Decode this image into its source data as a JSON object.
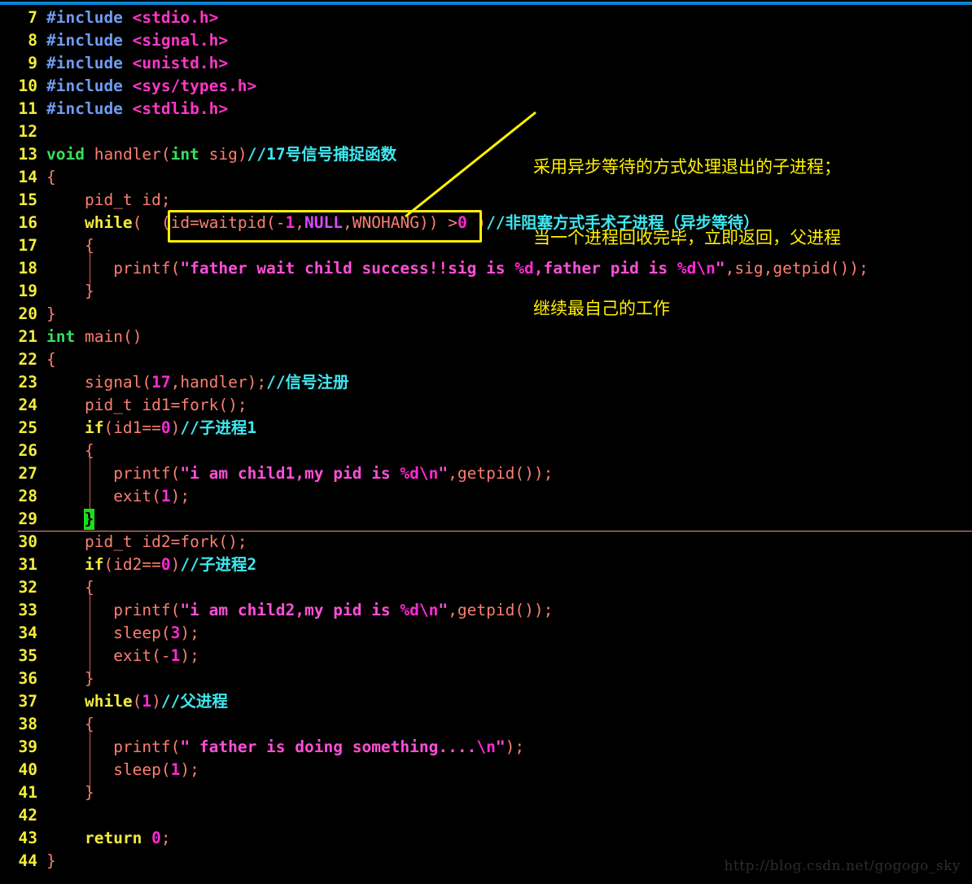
{
  "editor": {
    "background": "#000000",
    "top_strip_color": "#0a84d6",
    "line_number_color": "#f2ec3c",
    "first_line_number": 7,
    "last_line_number": 44
  },
  "cursor": {
    "line": 29,
    "char": "}",
    "block_color": "#19e019",
    "rule_color": "#f58b80"
  },
  "highlight_box": {
    "color": "#fff200",
    "text": "(id=waitpid(-1,NULL,WNOHANG))"
  },
  "annotation": {
    "color": "#fff200",
    "line1": "采用异步等待的方式处理退出的子进程；",
    "line2": "当一个进程回收完毕，立即返回，父进程",
    "line3": "继续最自己的工作"
  },
  "watermark": {
    "text": "http://blog.csdn.net/gogogo_sky"
  },
  "lines": [
    {
      "n": "7",
      "tokens": [
        {
          "c": "t-pre",
          "t": "#include"
        },
        {
          "c": "t-plain",
          "t": " "
        },
        {
          "c": "t-header",
          "t": "<stdio.h>"
        }
      ]
    },
    {
      "n": "8",
      "tokens": [
        {
          "c": "t-pre",
          "t": "#include"
        },
        {
          "c": "t-plain",
          "t": " "
        },
        {
          "c": "t-header",
          "t": "<signal.h>"
        }
      ]
    },
    {
      "n": "9",
      "tokens": [
        {
          "c": "t-pre",
          "t": "#include"
        },
        {
          "c": "t-plain",
          "t": " "
        },
        {
          "c": "t-header",
          "t": "<unistd.h>"
        }
      ]
    },
    {
      "n": "10",
      "tokens": [
        {
          "c": "t-pre",
          "t": "#include"
        },
        {
          "c": "t-plain",
          "t": " "
        },
        {
          "c": "t-header",
          "t": "<sys/types.h>"
        }
      ]
    },
    {
      "n": "11",
      "tokens": [
        {
          "c": "t-pre",
          "t": "#include"
        },
        {
          "c": "t-plain",
          "t": " "
        },
        {
          "c": "t-header",
          "t": "<stdlib.h>"
        }
      ]
    },
    {
      "n": "12",
      "tokens": []
    },
    {
      "n": "13",
      "tokens": [
        {
          "c": "t-kw",
          "t": "void"
        },
        {
          "c": "t-plain",
          "t": " "
        },
        {
          "c": "t-ident",
          "t": "handler"
        },
        {
          "c": "t-punc",
          "t": "("
        },
        {
          "c": "t-kw",
          "t": "int"
        },
        {
          "c": "t-plain",
          "t": " "
        },
        {
          "c": "t-ident",
          "t": "sig"
        },
        {
          "c": "t-punc",
          "t": ")"
        },
        {
          "c": "t-cmt",
          "t": "//17号信号捕捉函数"
        }
      ]
    },
    {
      "n": "14",
      "tokens": [
        {
          "c": "t-punc",
          "t": "{"
        }
      ]
    },
    {
      "n": "15",
      "tokens": [
        {
          "c": "t-plain",
          "t": "    "
        },
        {
          "c": "t-ident",
          "t": "pid_t id;"
        }
      ]
    },
    {
      "n": "16",
      "tokens": [
        {
          "c": "t-plain",
          "t": "    "
        },
        {
          "c": "t-kw2",
          "t": "while"
        },
        {
          "c": "t-punc",
          "t": "(  "
        },
        {
          "c": "t-punc",
          "t": "(id=waitpid("
        },
        {
          "c": "t-punc",
          "t": "-"
        },
        {
          "c": "t-num",
          "t": "1"
        },
        {
          "c": "t-punc",
          "t": ","
        },
        {
          "c": "t-const",
          "t": "NULL"
        },
        {
          "c": "t-punc",
          "t": ","
        },
        {
          "c": "t-ident",
          "t": "WNOHANG"
        },
        {
          "c": "t-punc",
          "t": "))"
        },
        {
          "c": "t-plain",
          "t": " "
        },
        {
          "c": "t-punc",
          "t": ">"
        },
        {
          "c": "t-num",
          "t": "0"
        },
        {
          "c": "t-punc",
          "t": " )"
        },
        {
          "c": "t-cmt",
          "t": "//非阻塞方式手术子进程（异步等待）"
        }
      ]
    },
    {
      "n": "17",
      "tokens": [
        {
          "c": "t-plain",
          "t": "    "
        },
        {
          "c": "t-punc",
          "t": "{"
        }
      ]
    },
    {
      "n": "18",
      "tokens": [
        {
          "c": "t-plain",
          "t": "       "
        },
        {
          "c": "t-ident",
          "t": "printf"
        },
        {
          "c": "t-punc",
          "t": "("
        },
        {
          "c": "t-str",
          "t": "\"father wait child success!!sig is "
        },
        {
          "c": "t-fmt",
          "t": "%d"
        },
        {
          "c": "t-str",
          "t": ",father pid is "
        },
        {
          "c": "t-fmt",
          "t": "%d\\n"
        },
        {
          "c": "t-str",
          "t": "\""
        },
        {
          "c": "t-punc",
          "t": ","
        },
        {
          "c": "t-ident",
          "t": "sig"
        },
        {
          "c": "t-punc",
          "t": ","
        },
        {
          "c": "t-ident",
          "t": "getpid"
        },
        {
          "c": "t-punc",
          "t": "());"
        }
      ]
    },
    {
      "n": "19",
      "tokens": [
        {
          "c": "t-plain",
          "t": "    "
        },
        {
          "c": "t-punc",
          "t": "}"
        }
      ]
    },
    {
      "n": "20",
      "tokens": [
        {
          "c": "t-punc",
          "t": "}"
        }
      ]
    },
    {
      "n": "21",
      "tokens": [
        {
          "c": "t-kw",
          "t": "int"
        },
        {
          "c": "t-plain",
          "t": " "
        },
        {
          "c": "t-ident",
          "t": "main"
        },
        {
          "c": "t-punc",
          "t": "()"
        }
      ]
    },
    {
      "n": "22",
      "tokens": [
        {
          "c": "t-punc",
          "t": "{"
        }
      ]
    },
    {
      "n": "23",
      "tokens": [
        {
          "c": "t-plain",
          "t": "    "
        },
        {
          "c": "t-ident",
          "t": "signal"
        },
        {
          "c": "t-punc",
          "t": "("
        },
        {
          "c": "t-num",
          "t": "17"
        },
        {
          "c": "t-punc",
          "t": ","
        },
        {
          "c": "t-ident",
          "t": "handler"
        },
        {
          "c": "t-punc",
          "t": ");"
        },
        {
          "c": "t-cmt",
          "t": "//信号注册"
        }
      ]
    },
    {
      "n": "24",
      "tokens": [
        {
          "c": "t-plain",
          "t": "    "
        },
        {
          "c": "t-ident",
          "t": "pid_t id1=fork();"
        }
      ]
    },
    {
      "n": "25",
      "tokens": [
        {
          "c": "t-plain",
          "t": "    "
        },
        {
          "c": "t-kw2",
          "t": "if"
        },
        {
          "c": "t-punc",
          "t": "(id1=="
        },
        {
          "c": "t-num",
          "t": "0"
        },
        {
          "c": "t-punc",
          "t": ")"
        },
        {
          "c": "t-cmt",
          "t": "//子进程1"
        }
      ]
    },
    {
      "n": "26",
      "tokens": [
        {
          "c": "t-plain",
          "t": "    "
        },
        {
          "c": "t-punc",
          "t": "{"
        }
      ]
    },
    {
      "n": "27",
      "tokens": [
        {
          "c": "t-plain",
          "t": "       "
        },
        {
          "c": "t-ident",
          "t": "printf"
        },
        {
          "c": "t-punc",
          "t": "("
        },
        {
          "c": "t-str",
          "t": "\"i am child1,my pid is "
        },
        {
          "c": "t-fmt",
          "t": "%d\\n"
        },
        {
          "c": "t-str",
          "t": "\""
        },
        {
          "c": "t-punc",
          "t": ","
        },
        {
          "c": "t-ident",
          "t": "getpid"
        },
        {
          "c": "t-punc",
          "t": "());"
        }
      ]
    },
    {
      "n": "28",
      "tokens": [
        {
          "c": "t-plain",
          "t": "       "
        },
        {
          "c": "t-ident",
          "t": "exit"
        },
        {
          "c": "t-punc",
          "t": "("
        },
        {
          "c": "t-num",
          "t": "1"
        },
        {
          "c": "t-punc",
          "t": ");"
        }
      ]
    },
    {
      "n": "29",
      "tokens": [
        {
          "c": "t-plain",
          "t": "    "
        },
        {
          "c": "t-punc",
          "t": "}"
        }
      ]
    },
    {
      "n": "30",
      "tokens": [
        {
          "c": "t-plain",
          "t": "    "
        },
        {
          "c": "t-ident",
          "t": "pid_t id2=fork();"
        }
      ]
    },
    {
      "n": "31",
      "tokens": [
        {
          "c": "t-plain",
          "t": "    "
        },
        {
          "c": "t-kw2",
          "t": "if"
        },
        {
          "c": "t-punc",
          "t": "(id2=="
        },
        {
          "c": "t-num",
          "t": "0"
        },
        {
          "c": "t-punc",
          "t": ")"
        },
        {
          "c": "t-cmt",
          "t": "//子进程2"
        }
      ]
    },
    {
      "n": "32",
      "tokens": [
        {
          "c": "t-plain",
          "t": "    "
        },
        {
          "c": "t-punc",
          "t": "{"
        }
      ]
    },
    {
      "n": "33",
      "tokens": [
        {
          "c": "t-plain",
          "t": "       "
        },
        {
          "c": "t-ident",
          "t": "printf"
        },
        {
          "c": "t-punc",
          "t": "("
        },
        {
          "c": "t-str",
          "t": "\"i am child2,my pid is "
        },
        {
          "c": "t-fmt",
          "t": "%d\\n"
        },
        {
          "c": "t-str",
          "t": "\""
        },
        {
          "c": "t-punc",
          "t": ","
        },
        {
          "c": "t-ident",
          "t": "getpid"
        },
        {
          "c": "t-punc",
          "t": "());"
        }
      ]
    },
    {
      "n": "34",
      "tokens": [
        {
          "c": "t-plain",
          "t": "       "
        },
        {
          "c": "t-ident",
          "t": "sleep"
        },
        {
          "c": "t-punc",
          "t": "("
        },
        {
          "c": "t-num",
          "t": "3"
        },
        {
          "c": "t-punc",
          "t": ");"
        }
      ]
    },
    {
      "n": "35",
      "tokens": [
        {
          "c": "t-plain",
          "t": "       "
        },
        {
          "c": "t-ident",
          "t": "exit"
        },
        {
          "c": "t-punc",
          "t": "("
        },
        {
          "c": "t-punc",
          "t": "-"
        },
        {
          "c": "t-num",
          "t": "1"
        },
        {
          "c": "t-punc",
          "t": ");"
        }
      ]
    },
    {
      "n": "36",
      "tokens": [
        {
          "c": "t-plain",
          "t": "    "
        },
        {
          "c": "t-punc",
          "t": "}"
        }
      ]
    },
    {
      "n": "37",
      "tokens": [
        {
          "c": "t-plain",
          "t": "    "
        },
        {
          "c": "t-kw2",
          "t": "while"
        },
        {
          "c": "t-punc",
          "t": "("
        },
        {
          "c": "t-num",
          "t": "1"
        },
        {
          "c": "t-punc",
          "t": ")"
        },
        {
          "c": "t-cmt",
          "t": "//父进程"
        }
      ]
    },
    {
      "n": "38",
      "tokens": [
        {
          "c": "t-plain",
          "t": "    "
        },
        {
          "c": "t-punc",
          "t": "{"
        }
      ]
    },
    {
      "n": "39",
      "tokens": [
        {
          "c": "t-plain",
          "t": "       "
        },
        {
          "c": "t-ident",
          "t": "printf"
        },
        {
          "c": "t-punc",
          "t": "("
        },
        {
          "c": "t-str",
          "t": "\" father is doing something...."
        },
        {
          "c": "t-fmt",
          "t": "\\n"
        },
        {
          "c": "t-str",
          "t": "\""
        },
        {
          "c": "t-punc",
          "t": ");"
        }
      ]
    },
    {
      "n": "40",
      "tokens": [
        {
          "c": "t-plain",
          "t": "       "
        },
        {
          "c": "t-ident",
          "t": "sleep"
        },
        {
          "c": "t-punc",
          "t": "("
        },
        {
          "c": "t-num",
          "t": "1"
        },
        {
          "c": "t-punc",
          "t": ");"
        }
      ]
    },
    {
      "n": "41",
      "tokens": [
        {
          "c": "t-plain",
          "t": "    "
        },
        {
          "c": "t-punc",
          "t": "}"
        }
      ]
    },
    {
      "n": "42",
      "tokens": []
    },
    {
      "n": "43",
      "tokens": [
        {
          "c": "t-plain",
          "t": "    "
        },
        {
          "c": "t-kw2",
          "t": "return"
        },
        {
          "c": "t-plain",
          "t": " "
        },
        {
          "c": "t-num",
          "t": "0"
        },
        {
          "c": "t-punc",
          "t": ";"
        }
      ]
    },
    {
      "n": "44",
      "tokens": [
        {
          "c": "t-punc",
          "t": "}"
        }
      ]
    }
  ]
}
